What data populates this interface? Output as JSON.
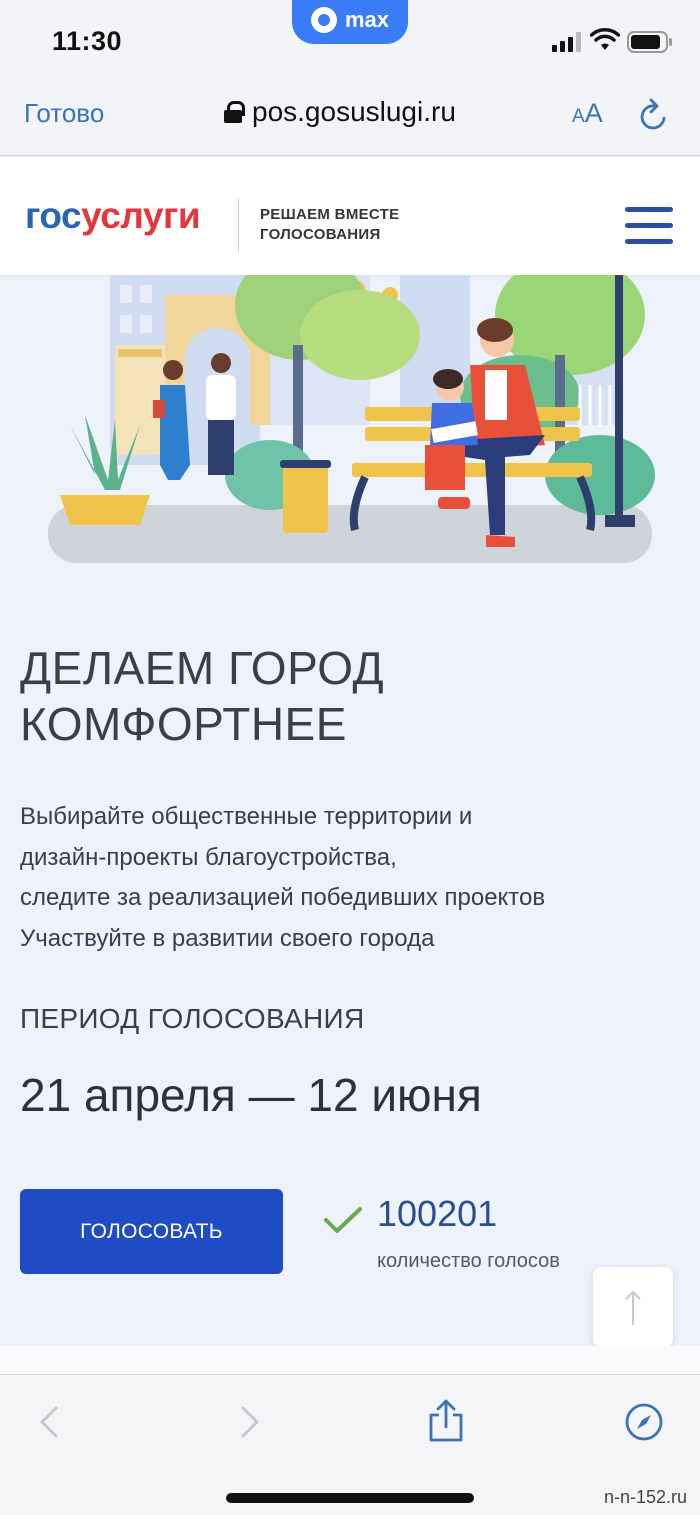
{
  "status_bar": {
    "time": "11:30",
    "app_pill": "max"
  },
  "browser": {
    "done_label": "Готово",
    "url": "pos.gosuslugi.ru",
    "text_size_label_small": "A",
    "text_size_label_large": "A"
  },
  "site_header": {
    "logo_part1": "гос",
    "logo_part2": "услуги",
    "tagline_line1": "РЕШАЕМ ВМЕСТЕ",
    "tagline_line2": "ГОЛОСОВАНИЯ",
    "menu_icon": "hamburger-menu-icon"
  },
  "main": {
    "headline_line1": "ДЕЛАЕМ ГОРОД",
    "headline_line2": "КОМФОРТНЕЕ",
    "description_lines": [
      "Выбирайте общественные территории и",
      "дизайн-проекты благоустройства,",
      "следите за реализацией победивших проектов",
      "Участвуйте в развитии своего города"
    ],
    "period_label": "ПЕРИОД ГОЛОСОВАНИЯ",
    "period_value": "21 апреля — 12 июня",
    "vote_button_label": "ГОЛОСОВАТЬ",
    "vote_count": "100201",
    "vote_count_label": "количество голосов"
  },
  "watermark": "n-n-152.ru",
  "colors": {
    "brand_blue": "#2d64b2",
    "brand_red": "#e3373d",
    "button_blue": "#1f4bc4",
    "check_green": "#6aa84f",
    "page_background": "#eef2fb"
  }
}
